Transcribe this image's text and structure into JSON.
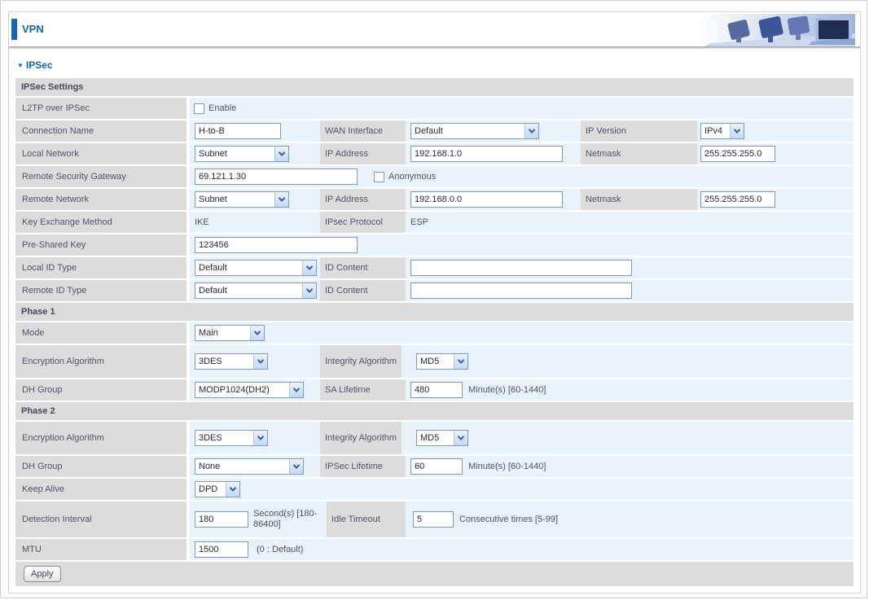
{
  "page": {
    "title": "VPN"
  },
  "section": {
    "title": "IPSec",
    "settings_header": "IPSec Settings",
    "phase1_header": "Phase 1",
    "phase2_header": "Phase 2"
  },
  "fields": {
    "l2tp": {
      "label": "L2TP over IPSec",
      "checkbox": "Enable",
      "checked": false
    },
    "connection_name": {
      "label": "Connection Name",
      "value": "H-to-B"
    },
    "wan_interface": {
      "label": "WAN Interface",
      "value": "Default"
    },
    "ip_version": {
      "label": "IP Version",
      "value": "IPv4"
    },
    "local_network": {
      "label": "Local Network",
      "value": "Subnet"
    },
    "local_ip": {
      "label": "IP Address",
      "value": "192.168.1.0"
    },
    "local_netmask": {
      "label": "Netmask",
      "value": "255.255.255.0"
    },
    "remote_gateway": {
      "label": "Remote Security Gateway",
      "value": "69.121.1.30",
      "checkbox": "Anonymous",
      "checked": false
    },
    "remote_network": {
      "label": "Remote Network",
      "value": "Subnet"
    },
    "remote_ip": {
      "label": "IP Address",
      "value": "192.168.0.0"
    },
    "remote_netmask": {
      "label": "Netmask",
      "value": "255.255.255.0"
    },
    "key_exchange": {
      "label": "Key Exchange Method",
      "value": "IKE"
    },
    "ipsec_protocol": {
      "label": "IPsec Protocol",
      "value": "ESP"
    },
    "pre_shared_key": {
      "label": "Pre-Shared Key",
      "value": "123456"
    },
    "local_id": {
      "label": "Local ID Type",
      "value": "Default",
      "content_label": "ID Content",
      "content_value": ""
    },
    "remote_id": {
      "label": "Remote ID Type",
      "value": "Default",
      "content_label": "ID Content",
      "content_value": ""
    },
    "phase1_mode": {
      "label": "Mode",
      "value": "Main"
    },
    "phase1_encryption": {
      "label": "Encryption Algorithm",
      "value": "3DES"
    },
    "phase1_integrity": {
      "label": "Integrity Algorithm",
      "value": "MD5"
    },
    "phase1_dh": {
      "label": "DH Group",
      "value": "MODP1024(DH2)"
    },
    "phase1_sa": {
      "label": "SA Lifetime",
      "value": "480",
      "hint": "Minute(s) [60-1440]"
    },
    "phase2_encryption": {
      "label": "Encryption Algorithm",
      "value": "3DES"
    },
    "phase2_integrity": {
      "label": "Integrity Algorithm",
      "value": "MD5"
    },
    "phase2_dh": {
      "label": "DH Group",
      "value": "None"
    },
    "phase2_lifetime": {
      "label": "IPSec Lifetime",
      "value": "60",
      "hint": "Minute(s) [60-1440]"
    },
    "keep_alive": {
      "label": "Keep Alive",
      "value": "DPD"
    },
    "detection_interval": {
      "label": "Detection Interval",
      "value": "180",
      "hint": "Second(s) [180-86400]"
    },
    "idle_timeout": {
      "label": "Idle Timeout",
      "value": "5",
      "hint": "Consecutive times [5-99]"
    },
    "mtu": {
      "label": "MTU",
      "value": "1500",
      "hint": "(0 : Default)"
    }
  },
  "buttons": {
    "apply": "Apply"
  },
  "colors": {
    "accent_blue": "#0F67AE",
    "bar_gray": "#DBDBDB",
    "row_blue": "#EAF2F9",
    "label_gray": "#DCDCDC"
  }
}
